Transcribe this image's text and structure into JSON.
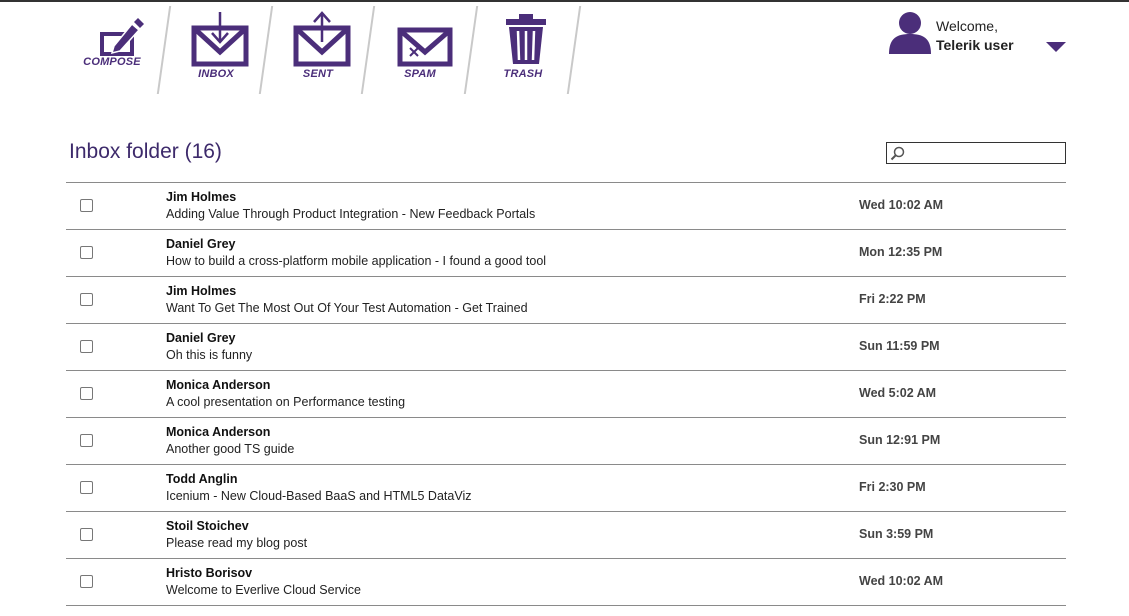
{
  "toolbar": {
    "compose": "COMPOSE",
    "inbox": "INBOX",
    "sent": "SENT",
    "spam": "SPAM",
    "trash": "TRASH"
  },
  "user": {
    "welcome": "Welcome,",
    "name": "Telerik user"
  },
  "folder": {
    "title": "Inbox folder (16)"
  },
  "search": {
    "value": ""
  },
  "colors": {
    "accent": "#4b2e7a"
  },
  "messages": [
    {
      "from": "Jim Holmes",
      "subject": "Adding Value Through Product Integration - New Feedback Portals",
      "date": "Wed 10:02 AM"
    },
    {
      "from": "Daniel Grey",
      "subject": "How to build a cross-platform mobile application - I found a good tool",
      "date": "Mon 12:35 PM"
    },
    {
      "from": "Jim Holmes",
      "subject": "Want To Get The Most Out Of Your Test Automation - Get Trained",
      "date": "Fri 2:22 PM"
    },
    {
      "from": "Daniel Grey",
      "subject": "Oh this is funny",
      "date": "Sun 11:59 PM"
    },
    {
      "from": "Monica Anderson",
      "subject": "A cool presentation on Performance testing",
      "date": "Wed 5:02 AM"
    },
    {
      "from": "Monica Anderson",
      "subject": "Another good TS guide",
      "date": "Sun 12:91 PM"
    },
    {
      "from": "Todd Anglin",
      "subject": "Icenium - New Cloud-Based BaaS and HTML5 DataViz",
      "date": "Fri 2:30 PM"
    },
    {
      "from": "Stoil Stoichev",
      "subject": "Please read my blog post",
      "date": "Sun 3:59 PM"
    },
    {
      "from": "Hristo Borisov",
      "subject": "Welcome to Everlive Cloud Service",
      "date": "Wed 10:02 AM"
    }
  ]
}
